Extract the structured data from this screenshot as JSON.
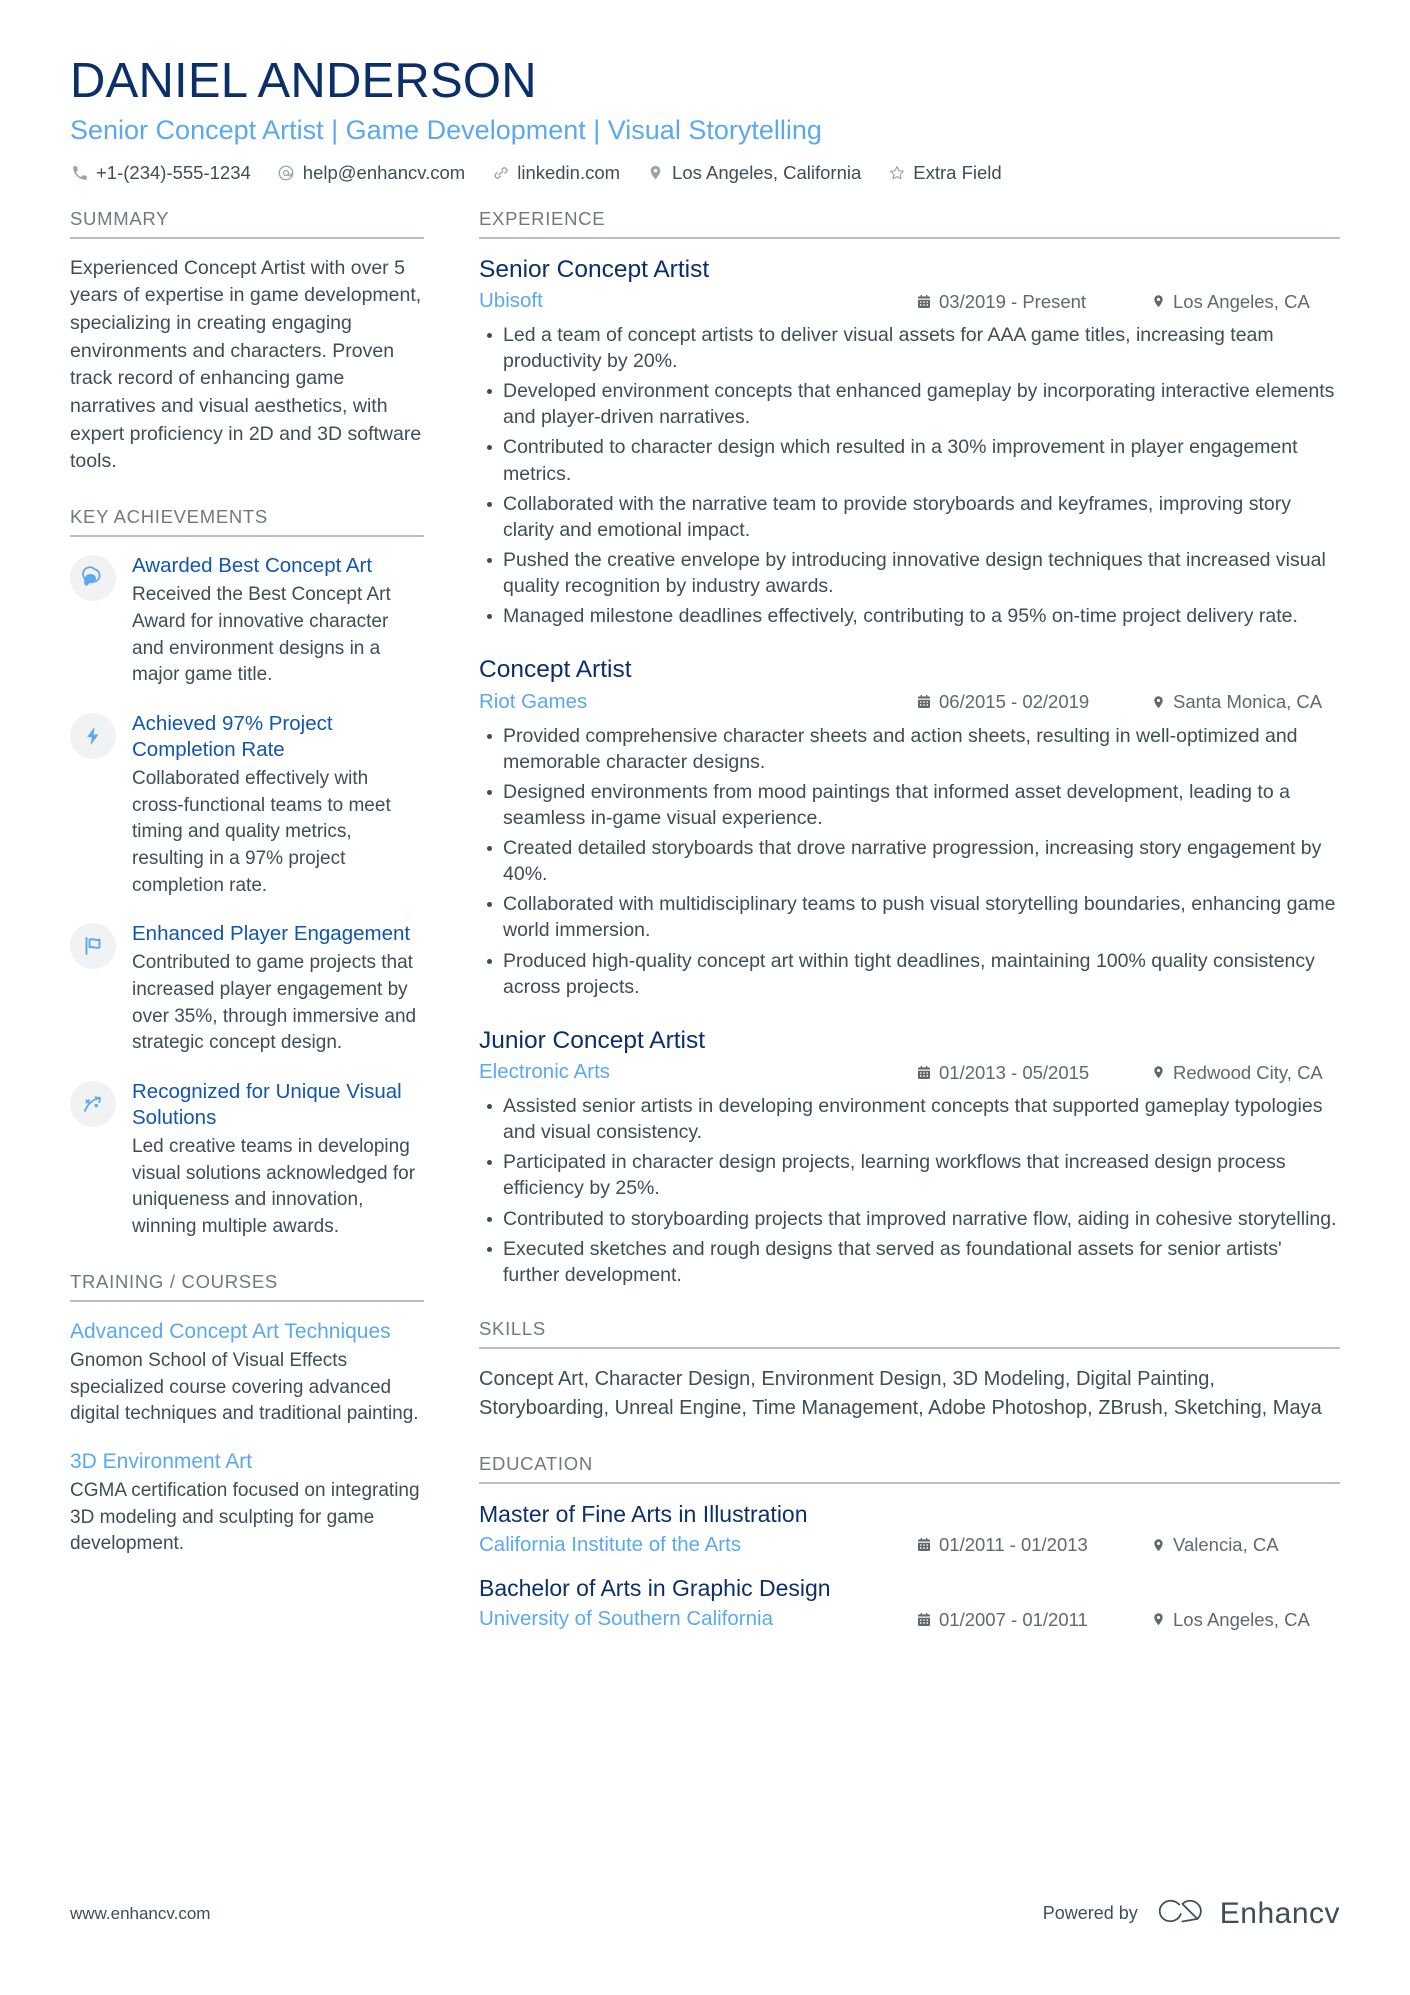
{
  "colors": {
    "navy": "#0b2f6b",
    "light_blue": "#5aa9f0",
    "link_blue": "#1156b0",
    "body_text": "#3f4d57",
    "muted": "#70797f",
    "rule": "#b9bfc4",
    "icon_bubble_bg": "#f1f2f3"
  },
  "header": {
    "name": "DANIEL ANDERSON",
    "headline": "Senior Concept Artist | Game Development | Visual Storytelling",
    "contacts": [
      {
        "icon": "phone-icon",
        "text": "+1-(234)-555-1234"
      },
      {
        "icon": "email-icon",
        "text": "help@enhancv.com"
      },
      {
        "icon": "link-icon",
        "text": "linkedin.com"
      },
      {
        "icon": "location-pin-icon",
        "text": "Los Angeles, California"
      },
      {
        "icon": "star-icon",
        "text": "Extra Field"
      }
    ]
  },
  "left": {
    "summary": {
      "title": "SUMMARY",
      "text": "Experienced Concept Artist with over 5 years of expertise in game development, specializing in creating engaging environments and characters. Proven track record of enhancing game narratives and visual aesthetics, with expert proficiency in 2D and 3D software tools."
    },
    "achievements": {
      "title": "KEY ACHIEVEMENTS",
      "items": [
        {
          "icon": "speech-bubble-pin-icon",
          "title": "Awarded Best Concept Art",
          "desc": "Received the Best Concept Art Award for innovative character and environment designs in a major game title."
        },
        {
          "icon": "lightning-bolt-icon",
          "title": "Achieved 97% Project Completion Rate",
          "desc": "Collaborated effectively with cross-functional teams to meet timing and quality metrics, resulting in a 97% project completion rate."
        },
        {
          "icon": "flag-icon",
          "title": "Enhanced Player Engagement",
          "desc": "Contributed to game projects that increased player engagement by over 35%, through immersive and strategic concept design."
        },
        {
          "icon": "strategy-arrow-icon",
          "title": "Recognized for Unique Visual Solutions",
          "desc": "Led creative teams in developing visual solutions acknowledged for uniqueness and innovation, winning multiple awards."
        }
      ]
    },
    "training": {
      "title": "TRAINING / COURSES",
      "items": [
        {
          "title": "Advanced Concept Art Techniques",
          "desc": "Gnomon School of Visual Effects specialized course covering advanced digital techniques and traditional painting."
        },
        {
          "title": "3D Environment Art",
          "desc": "CGMA certification focused on integrating 3D modeling and sculpting for game development."
        }
      ]
    }
  },
  "right": {
    "experience": {
      "title": "EXPERIENCE",
      "jobs": [
        {
          "role": "Senior Concept Artist",
          "company": "Ubisoft",
          "date": "03/2019 - Present",
          "location": "Los Angeles, CA",
          "bullets": [
            "Led a team of concept artists to deliver visual assets for AAA game titles, increasing team productivity by 20%.",
            "Developed environment concepts that enhanced gameplay by incorporating interactive elements and player-driven narratives.",
            "Contributed to character design which resulted in a 30% improvement in player engagement metrics.",
            "Collaborated with the narrative team to provide storyboards and keyframes, improving story clarity and emotional impact.",
            "Pushed the creative envelope by introducing innovative design techniques that increased visual quality recognition by industry awards.",
            "Managed milestone deadlines effectively, contributing to a 95% on-time project delivery rate."
          ]
        },
        {
          "role": "Concept Artist",
          "company": "Riot Games",
          "date": "06/2015 - 02/2019",
          "location": "Santa Monica, CA",
          "bullets": [
            "Provided comprehensive character sheets and action sheets, resulting in well-optimized and memorable character designs.",
            "Designed environments from mood paintings that informed asset development, leading to a seamless in-game visual experience.",
            "Created detailed storyboards that drove narrative progression, increasing story engagement by 40%.",
            "Collaborated with multidisciplinary teams to push visual storytelling boundaries, enhancing game world immersion.",
            "Produced high-quality concept art within tight deadlines, maintaining 100% quality consistency across projects."
          ]
        },
        {
          "role": "Junior Concept Artist",
          "company": "Electronic Arts",
          "date": "01/2013 - 05/2015",
          "location": "Redwood City, CA",
          "bullets": [
            "Assisted senior artists in developing environment concepts that supported gameplay typologies and visual consistency.",
            "Participated in character design projects, learning workflows that increased design process efficiency by 25%.",
            "Contributed to storyboarding projects that improved narrative flow, aiding in cohesive storytelling.",
            "Executed sketches and rough designs that served as foundational assets for senior artists' further development."
          ]
        }
      ]
    },
    "skills": {
      "title": "SKILLS",
      "text": "Concept Art, Character Design, Environment Design, 3D Modeling, Digital Painting, Storyboarding, Unreal Engine, Time Management, Adobe Photoshop, ZBrush, Sketching, Maya"
    },
    "education": {
      "title": "EDUCATION",
      "items": [
        {
          "degree": "Master of Fine Arts in Illustration",
          "school": "California Institute of the Arts",
          "date": "01/2011 - 01/2013",
          "location": "Valencia, CA"
        },
        {
          "degree": "Bachelor of Arts in Graphic Design",
          "school": "University of Southern California",
          "date": "01/2007 - 01/2011",
          "location": "Los Angeles, CA"
        }
      ]
    }
  },
  "footer": {
    "url": "www.enhancv.com",
    "powered_by": "Powered by",
    "brand": "Enhancv"
  }
}
